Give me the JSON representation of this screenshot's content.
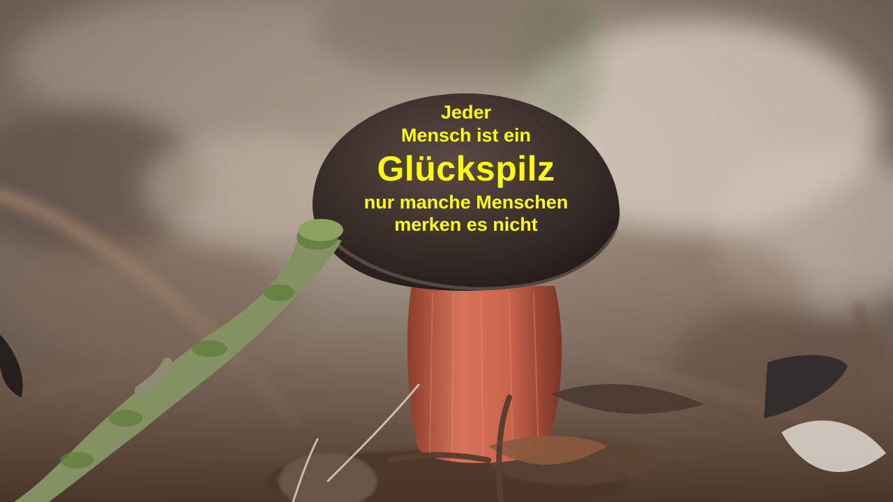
{
  "image": {
    "subject": "mushroom-photo",
    "colors": {
      "background": "#6e6258",
      "cap": "#3d322d",
      "stem": "#c4624a",
      "moss": "#6e8a4a",
      "text": "#ffff00"
    }
  },
  "quote": {
    "line1": "Jeder",
    "line2": "Mensch ist ein",
    "line3": "Glückspilz",
    "line4": "nur manche Menschen",
    "line5": "merken es nicht"
  }
}
